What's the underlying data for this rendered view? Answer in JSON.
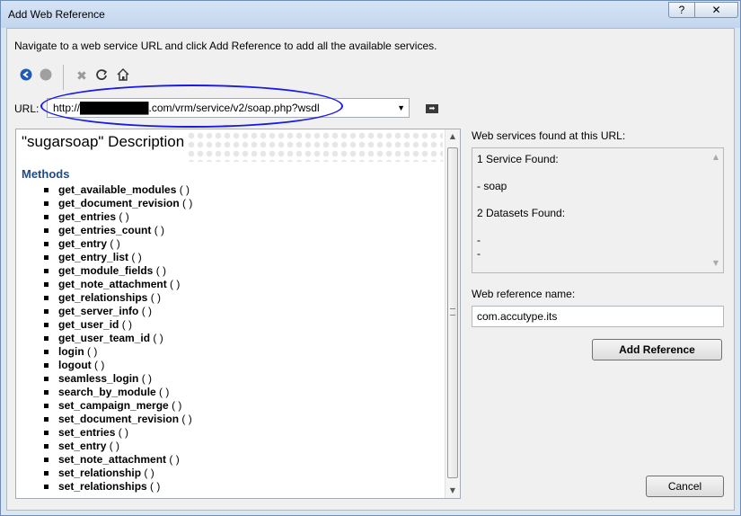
{
  "window": {
    "title": "Add Web Reference",
    "help_label": "?",
    "close_label": "✕"
  },
  "instruction": "Navigate to a web service URL and click Add Reference to add all the available services.",
  "toolbar": {
    "items": [
      "back-icon",
      "forward-icon",
      "stop-icon",
      "refresh-icon",
      "home-icon"
    ]
  },
  "url": {
    "label": "URL:",
    "value": "http://█████████.com/vrm/service/v2/soap.php?wsdl"
  },
  "description": {
    "title": "\"sugarsoap\" Description",
    "methods_heading": "Methods",
    "methods": [
      "get_available_modules",
      "get_document_revision",
      "get_entries",
      "get_entries_count",
      "get_entry",
      "get_entry_list",
      "get_module_fields",
      "get_note_attachment",
      "get_relationships",
      "get_server_info",
      "get_user_id",
      "get_user_team_id",
      "login",
      "logout",
      "seamless_login",
      "search_by_module",
      "set_campaign_merge",
      "set_document_revision",
      "set_entries",
      "set_entry",
      "set_note_attachment",
      "set_relationship",
      "set_relationships"
    ],
    "method_suffix": " ( )"
  },
  "services": {
    "label": "Web services found at this URL:",
    "lines": [
      "1 Service Found:",
      "- soap",
      "2 Datasets Found:",
      "-",
      "-"
    ]
  },
  "reference": {
    "label": "Web reference name:",
    "value": "com.accutype.its"
  },
  "buttons": {
    "add_reference": "Add Reference",
    "cancel": "Cancel"
  }
}
